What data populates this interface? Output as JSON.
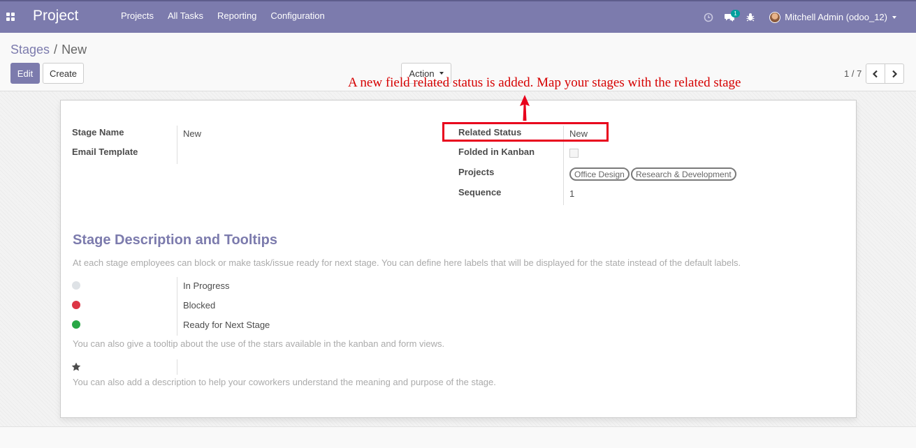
{
  "navbar": {
    "brand": "Project",
    "menu": [
      "Projects",
      "All Tasks",
      "Reporting",
      "Configuration"
    ],
    "messages_badge": "1",
    "user": "Mitchell Admin (odoo_12)"
  },
  "breadcrumb": {
    "parent": "Stages",
    "separator": "/",
    "current": "New"
  },
  "buttons": {
    "edit": "Edit",
    "create": "Create",
    "action": "Action"
  },
  "pager": {
    "text": "1 / 7"
  },
  "form": {
    "left": {
      "stage_name_label": "Stage Name",
      "stage_name_value": "New",
      "email_template_label": "Email Template"
    },
    "right": {
      "related_status_label": "Related Status",
      "related_status_value": "New",
      "folded_label": "Folded in Kanban",
      "projects_label": "Projects",
      "projects_tags": [
        "Office Design",
        "Research & Development"
      ],
      "sequence_label": "Sequence",
      "sequence_value": "1"
    }
  },
  "description": {
    "title": "Stage Description and Tooltips",
    "help_states": "At each stage employees can block or make task/issue ready for next stage. You can define here labels that will be displayed for the state instead of the default labels.",
    "states": [
      {
        "label": "In Progress",
        "color": "#dee2e6"
      },
      {
        "label": "Blocked",
        "color": "#dc3545"
      },
      {
        "label": "Ready for Next Stage",
        "color": "#28a745"
      }
    ],
    "help_stars": "You can also give a tooltip about the use of the stars available in the kanban and form views.",
    "help_description": "You can also add a description to help your coworkers understand the meaning and purpose of the stage."
  },
  "annotation": {
    "text": "A new field related status is added. Map your stages with the related stage",
    "color": "#e8001c"
  }
}
